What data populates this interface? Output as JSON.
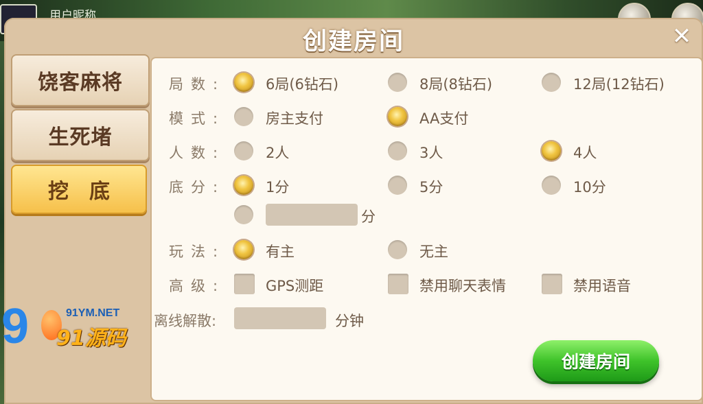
{
  "background": {
    "nickname": "用户昵称"
  },
  "modal": {
    "title": "创建房间",
    "close_label": "✕"
  },
  "tabs": [
    {
      "label": "饶客麻将",
      "active": false
    },
    {
      "label": "生死堵",
      "active": false
    },
    {
      "label": "挖底",
      "active": true
    }
  ],
  "form": {
    "rounds": {
      "label": "局数:",
      "options": [
        "6局(6钻石)",
        "8局(8钻石)",
        "12局(12钻石)"
      ],
      "selected": 0
    },
    "mode": {
      "label": "模式:",
      "options": [
        "房主支付",
        "AA支付"
      ],
      "selected": 1
    },
    "players": {
      "label": "人数:",
      "options": [
        "2人",
        "3人",
        "4人"
      ],
      "selected": 2
    },
    "base_score": {
      "label": "底分:",
      "options": [
        "1分",
        "5分",
        "10分"
      ],
      "selected": 0,
      "custom_suffix": "分",
      "custom_value": ""
    },
    "play": {
      "label": "玩法:",
      "options": [
        "有主",
        "无主"
      ],
      "selected": 0
    },
    "advanced": {
      "label": "高级:",
      "options": [
        "GPS测距",
        "禁用聊天表情",
        "禁用语音"
      ],
      "checked": [
        false,
        false,
        false
      ]
    },
    "dissolve": {
      "label": "离线解散:",
      "value": "",
      "suffix": "分钟"
    }
  },
  "create_button": "创建房间",
  "watermark": {
    "digits": "9",
    "url": "91YM.NET",
    "brand": "91源码"
  },
  "colors": {
    "modal_bg": "#dcc4a4",
    "panel_bg": "#fdf9f1",
    "active_tab": "#f6c04a",
    "create_green": "#3fc32a"
  }
}
